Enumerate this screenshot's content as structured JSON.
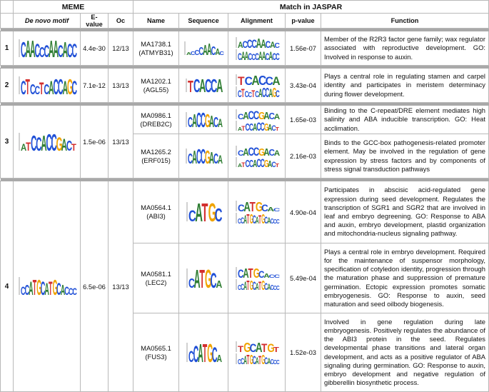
{
  "header": {
    "meme": "MEME",
    "jaspar": "Match in JASPAR",
    "cols": [
      "De novo motif",
      "E-value",
      "Oc",
      "Name",
      "Sequence",
      "Alignment",
      "p-value",
      "Function"
    ]
  },
  "groups": [
    {
      "num": "1",
      "evalue": "4.4e-30",
      "oc": "12/13",
      "motif_icon": "sequence-logo-CAACCCAACACC",
      "matches": [
        {
          "id": "MA1738.1",
          "gene": "(ATMYB31)",
          "pvalue": "1.56e-07",
          "function": "Member of the R2R3 factor gene family; wax regulator associated with reproductive development. GO: Involved in response to auxin."
        }
      ]
    },
    {
      "num": "2",
      "evalue": "7.1e-12",
      "oc": "13/13",
      "motif_icon": "sequence-logo-CTCCTCACCAGC",
      "matches": [
        {
          "id": "MA1202.1",
          "gene": "(AGL55)",
          "pvalue": "3.43e-04",
          "function": "Plays a central role in regulating stamen and carpel identity and participates in meristem determinacy during flower development."
        }
      ]
    },
    {
      "num": "3",
      "evalue": "1.5e-06",
      "oc": "13/13",
      "motif_icon": "sequence-logo-ATCCACCGACT",
      "matches": [
        {
          "id": "MA0986.1",
          "gene": "(DREB2C)",
          "pvalue": "1.65e-03",
          "function": "Binding to the C-repeat/DRE element mediates high salinity and ABA inducible transcription. GO: Heat acclimation."
        },
        {
          "id": "MA1265.2",
          "gene": "(ERF015)",
          "pvalue": "2.16e-03",
          "function": "Binds to the GCC-box pathogenesis-related promoter element. May be involved in the regulation of gene expression by stress factors and by components of stress signal transduction pathways"
        }
      ]
    },
    {
      "num": "4",
      "evalue": "6.5e-06",
      "oc": "13/13",
      "motif_icon": "sequence-logo-CCATGCATGCACCC",
      "matches": [
        {
          "id": "MA0564.1",
          "gene": "(ABI3)",
          "pvalue": "4.90e-04",
          "function": "Participates in abscisic acid-regulated gene expression during seed development. Regulates the transcription of SGR1 and SGR2 that are involved in leaf and embryo degreening. GO: Response to ABA and auxin, embryo development, plastid organization and mitochondria-nucleus signaling pathway."
        },
        {
          "id": "MA0581.1",
          "gene": "(LEC2)",
          "pvalue": "5.49e-04",
          "function": "Plays a central role in embryo development. Required for the maintenance of suspensor morphology, specification of cotyledon identity, progression through the maturation phase and suppression of premature germination. Ectopic expression promotes somatic embryogenesis. GO: Response to auxin, seed maturation and seed oilbody biogenesis."
        },
        {
          "id": "MA0565.1",
          "gene": "(FUS3)",
          "pvalue": "1.52e-03",
          "function": "Involved in gene regulation during late embryogenesis. Positively regulates the abundance of the ABI3 protein in the seed. Regulates developmental phase transitions and lateral organ development, and acts as a positive regulator of ABA signaling during germination. GO: Response to auxin, embryo development and negative regulation of gibberellin biosynthetic process."
        }
      ]
    }
  ],
  "colors": {
    "A": "#2e7d32",
    "C": "#1f4fd6",
    "G": "#f0a400",
    "T": "#d32f2f"
  }
}
